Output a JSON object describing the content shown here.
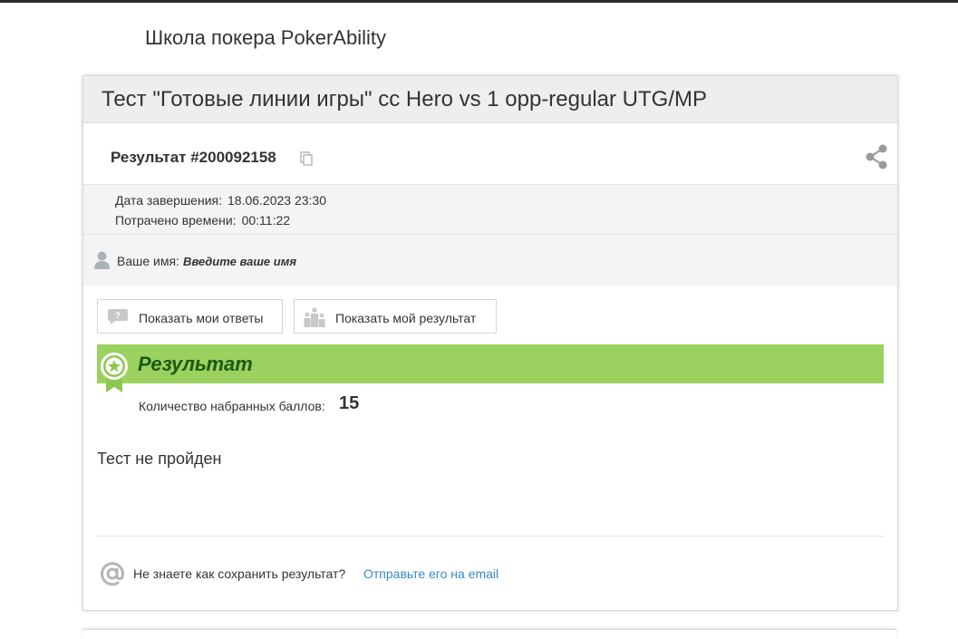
{
  "site": {
    "title": "Школа покера PokerAbility"
  },
  "test": {
    "title": "Тест \"Готовые линии игры\" cc Hero vs 1 opp-regular UTG/MP"
  },
  "result": {
    "id_label": "Результат #200092158",
    "copy_icon": "copy-icon",
    "share_icon": "share-icon"
  },
  "meta": {
    "finished_label": "Дата завершения:",
    "finished_value": "18.06.2023 23:30",
    "spent_label": "Потрачено времени:",
    "spent_value": "00:11:22"
  },
  "name": {
    "label": "Ваше имя:",
    "placeholder": "Введите ваше имя",
    "icon": "user-icon"
  },
  "actions": {
    "show_answers": "Показать мои ответы",
    "show_result": "Показать мой результат"
  },
  "banner": {
    "title": "Результат",
    "color": "#9bd15f",
    "title_color": "#1c5a10"
  },
  "score": {
    "label": "Количество набранных баллов:",
    "value": "15"
  },
  "verdict": "Тест не пройден",
  "email": {
    "question": "Не знаете как сохранить результат?",
    "link": "Отправьте его на email",
    "link_color": "#3a87c9"
  }
}
